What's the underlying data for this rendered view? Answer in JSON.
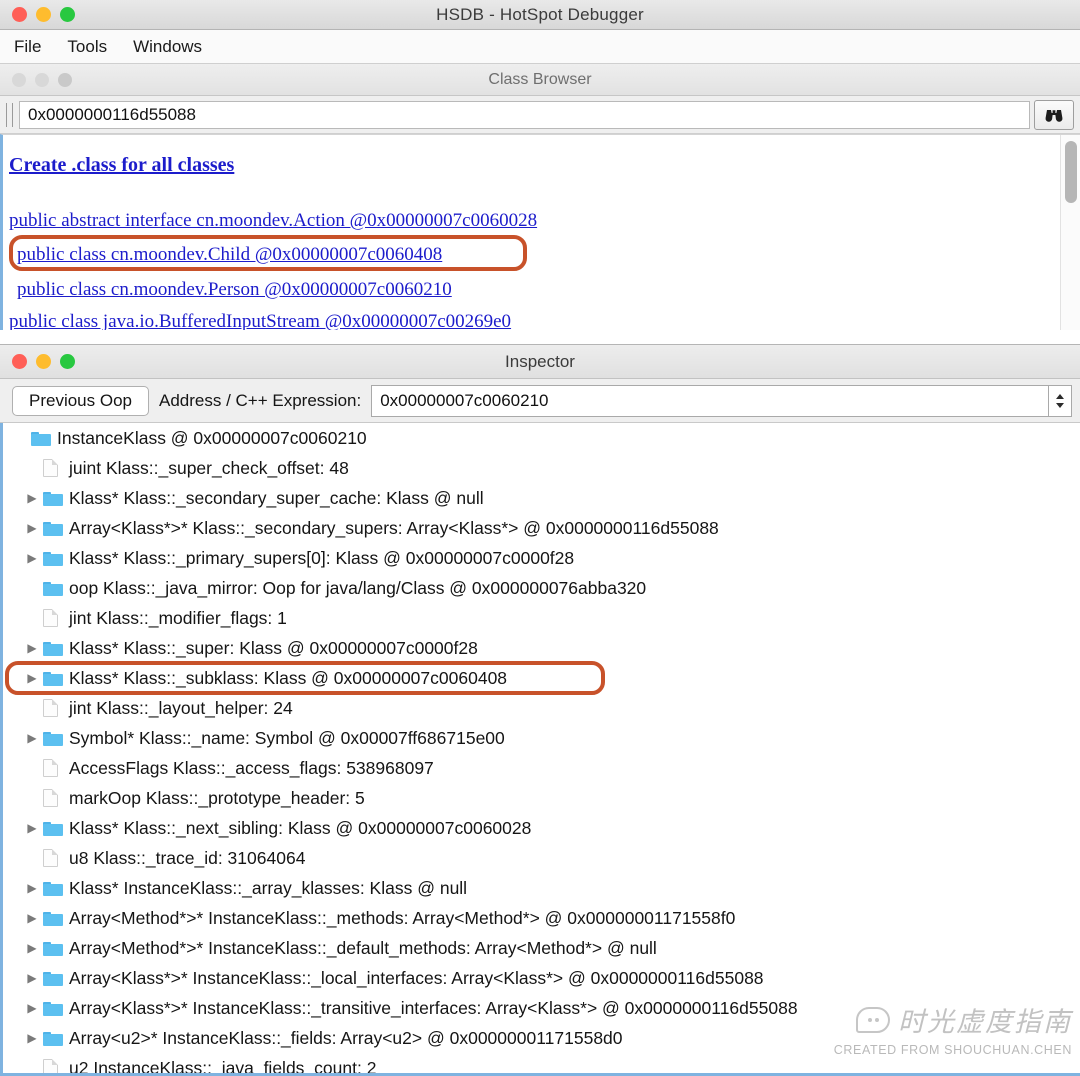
{
  "window": {
    "title": "HSDB - HotSpot Debugger",
    "traffic": [
      "close",
      "minimize",
      "zoom"
    ]
  },
  "menubar": {
    "items": [
      {
        "label": "File"
      },
      {
        "label": "Tools"
      },
      {
        "label": "Windows"
      }
    ]
  },
  "class_browser": {
    "title": "Class Browser",
    "search_value": "0x0000000116d55088",
    "search_placeholder": "",
    "search_button_icon": "binoculars-icon",
    "create_link": "Create .class for all classes",
    "classes": [
      {
        "text": "public abstract interface cn.moondev.Action @0x00000007c0060028",
        "highlighted": false
      },
      {
        "text": "public class cn.moondev.Child @0x00000007c0060408",
        "highlighted": true
      },
      {
        "text": "public class cn.moondev.Person @0x00000007c0060210",
        "highlighted": false
      },
      {
        "text": "public class java.io.BufferedInputStream @0x00000007c00269e0",
        "highlighted": false
      }
    ]
  },
  "inspector": {
    "title": "Inspector",
    "previous_oop_label": "Previous Oop",
    "address_label": "Address / C++ Expression:",
    "address_value": "0x00000007c0060210",
    "stepper_icon": "up-down-stepper-icon",
    "rows": [
      {
        "indent": 0,
        "twisty": "none",
        "icon": "folder",
        "text": "InstanceKlass @ 0x00000007c0060210",
        "highlighted": false
      },
      {
        "indent": 1,
        "twisty": "none",
        "icon": "document",
        "text": "juint Klass::_super_check_offset: 48",
        "highlighted": false
      },
      {
        "indent": 1,
        "twisty": "right",
        "icon": "folder",
        "text": "Klass* Klass::_secondary_super_cache: Klass @ null",
        "highlighted": false
      },
      {
        "indent": 1,
        "twisty": "right",
        "icon": "folder",
        "text": "Array<Klass*>* Klass::_secondary_supers: Array<Klass*> @ 0x0000000116d55088",
        "highlighted": false
      },
      {
        "indent": 1,
        "twisty": "right",
        "icon": "folder",
        "text": "Klass* Klass::_primary_supers[0]: Klass @ 0x00000007c0000f28",
        "highlighted": false
      },
      {
        "indent": 1,
        "twisty": "none",
        "icon": "folder",
        "text": "oop Klass::_java_mirror: Oop for java/lang/Class @ 0x000000076abba320",
        "highlighted": false
      },
      {
        "indent": 1,
        "twisty": "none",
        "icon": "document",
        "text": "jint Klass::_modifier_flags: 1",
        "highlighted": false
      },
      {
        "indent": 1,
        "twisty": "right",
        "icon": "folder",
        "text": "Klass* Klass::_super: Klass @ 0x00000007c0000f28",
        "highlighted": false
      },
      {
        "indent": 1,
        "twisty": "right",
        "icon": "folder",
        "text": "Klass* Klass::_subklass: Klass @ 0x00000007c0060408",
        "highlighted": true
      },
      {
        "indent": 1,
        "twisty": "none",
        "icon": "document",
        "text": "jint Klass::_layout_helper: 24",
        "highlighted": false
      },
      {
        "indent": 1,
        "twisty": "right",
        "icon": "folder",
        "text": "Symbol* Klass::_name: Symbol @ 0x00007ff686715e00",
        "highlighted": false
      },
      {
        "indent": 1,
        "twisty": "none",
        "icon": "document",
        "text": "AccessFlags Klass::_access_flags: 538968097",
        "highlighted": false
      },
      {
        "indent": 1,
        "twisty": "none",
        "icon": "document",
        "text": "markOop Klass::_prototype_header: 5",
        "highlighted": false
      },
      {
        "indent": 1,
        "twisty": "right",
        "icon": "folder",
        "text": "Klass* Klass::_next_sibling: Klass @ 0x00000007c0060028",
        "highlighted": false
      },
      {
        "indent": 1,
        "twisty": "none",
        "icon": "document",
        "text": "u8 Klass::_trace_id: 31064064",
        "highlighted": false
      },
      {
        "indent": 1,
        "twisty": "right",
        "icon": "folder",
        "text": "Klass* InstanceKlass::_array_klasses: Klass @ null",
        "highlighted": false
      },
      {
        "indent": 1,
        "twisty": "right",
        "icon": "folder",
        "text": "Array<Method*>* InstanceKlass::_methods: Array<Method*> @ 0x00000001171558f0",
        "highlighted": false
      },
      {
        "indent": 1,
        "twisty": "right",
        "icon": "folder",
        "text": "Array<Method*>* InstanceKlass::_default_methods: Array<Method*> @ null",
        "highlighted": false
      },
      {
        "indent": 1,
        "twisty": "right",
        "icon": "folder",
        "text": "Array<Klass*>* InstanceKlass::_local_interfaces: Array<Klass*> @ 0x0000000116d55088",
        "highlighted": false
      },
      {
        "indent": 1,
        "twisty": "right",
        "icon": "folder",
        "text": "Array<Klass*>* InstanceKlass::_transitive_interfaces: Array<Klass*> @ 0x0000000116d55088",
        "highlighted": false
      },
      {
        "indent": 1,
        "twisty": "right",
        "icon": "folder",
        "text": "Array<u2>* InstanceKlass::_fields: Array<u2> @ 0x00000001171558d0",
        "highlighted": false
      },
      {
        "indent": 1,
        "twisty": "none",
        "icon": "document",
        "text": "u2 InstanceKlass::_java_fields_count: 2",
        "highlighted": false
      }
    ]
  },
  "watermark": {
    "chinese": "时光虚度指南",
    "english": "CREATED FROM SHOUCHUAN.CHEN"
  },
  "colors": {
    "highlight": "#c8522a",
    "link": "#1c1ccb",
    "folder": "#5cc0f0",
    "accent_border": "#7fb3e0"
  }
}
